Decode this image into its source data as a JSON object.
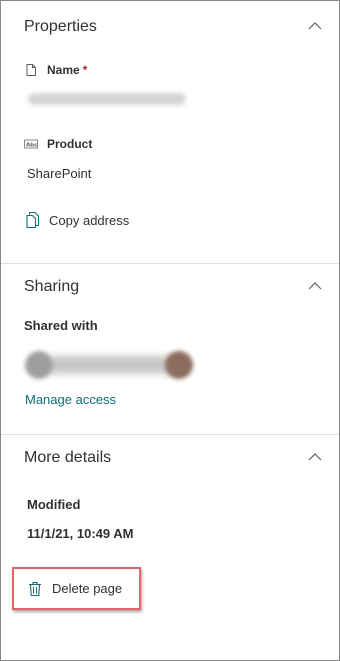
{
  "properties": {
    "title": "Properties",
    "name_label": "Name",
    "required_marker": "*",
    "product_label": "Product",
    "product_value": "SharePoint",
    "copy_address_label": "Copy address"
  },
  "sharing": {
    "title": "Sharing",
    "shared_with_label": "Shared with",
    "manage_access_label": "Manage access"
  },
  "more_details": {
    "title": "More details",
    "modified_label": "Modified",
    "modified_value": "11/1/21, 10:49 AM",
    "delete_label": "Delete page"
  },
  "colors": {
    "link": "#0f6e76",
    "highlight_border": "#e06666",
    "required": "#a4262c"
  },
  "icons": [
    "chevron-up-icon",
    "document-icon",
    "text-field-icon",
    "copy-icon",
    "trash-icon"
  ]
}
